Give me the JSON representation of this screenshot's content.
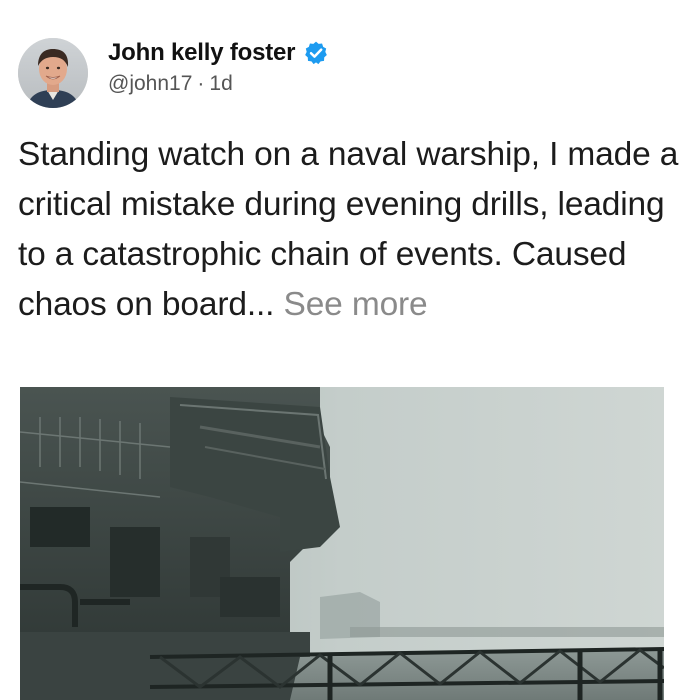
{
  "author": {
    "name": "John kelly foster",
    "handle": "@john17",
    "separator": "·",
    "time": "1d",
    "avatar_icon": "profile-photo",
    "verified_icon": "verified-badge-icon"
  },
  "post": {
    "text": "Standing watch on a naval warship, I made a critical mistake during evening drills, leading to a catastrophic chain of events. Caused chaos on board...",
    "see_more_label": "See more"
  },
  "media": {
    "type": "photo"
  },
  "colors": {
    "verified_blue": "#1d9bf0",
    "text": "#1c1c1c",
    "meta": "#555555",
    "see_more": "#8a8a8a"
  }
}
